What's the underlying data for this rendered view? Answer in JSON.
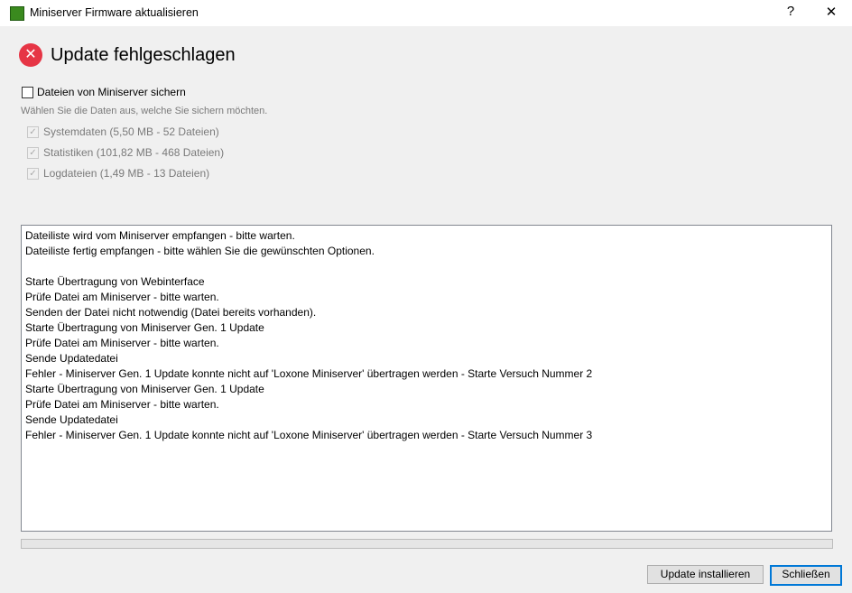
{
  "window": {
    "title": "Miniserver Firmware aktualisieren",
    "help": "?",
    "close": "✕"
  },
  "heading": "Update fehlgeschlagen",
  "backup": {
    "label": "Dateien von Miniserver sichern",
    "checked": false,
    "hint": "Wählen Sie die Daten aus, welche Sie sichern möchten.",
    "options": [
      {
        "label": "Systemdaten (5,50 MB - 52 Dateien)",
        "checked": true
      },
      {
        "label": "Statistiken (101,82 MB - 468 Dateien)",
        "checked": true
      },
      {
        "label": "Logdateien (1,49 MB - 13 Dateien)",
        "checked": true
      }
    ]
  },
  "log": [
    "Dateiliste wird vom Miniserver empfangen - bitte warten.",
    "Dateiliste fertig empfangen - bitte wählen Sie die gewünschten Optionen.",
    " ",
    "Starte Übertragung von Webinterface",
    "Prüfe Datei am Miniserver - bitte warten.",
    "Senden der Datei nicht notwendig (Datei bereits vorhanden).",
    "Starte Übertragung von Miniserver Gen. 1 Update",
    "Prüfe Datei am Miniserver - bitte warten.",
    "Sende Updatedatei",
    "Fehler - Miniserver Gen. 1 Update konnte nicht auf 'Loxone Miniserver' übertragen werden - Starte Versuch Nummer 2",
    "Starte Übertragung von Miniserver Gen. 1 Update",
    "Prüfe Datei am Miniserver - bitte warten.",
    "Sende Updatedatei",
    "Fehler - Miniserver Gen. 1 Update konnte nicht auf 'Loxone Miniserver' übertragen werden - Starte Versuch Nummer 3"
  ],
  "progress": 0,
  "buttons": {
    "install": "Update installieren",
    "close": "Schließen"
  }
}
